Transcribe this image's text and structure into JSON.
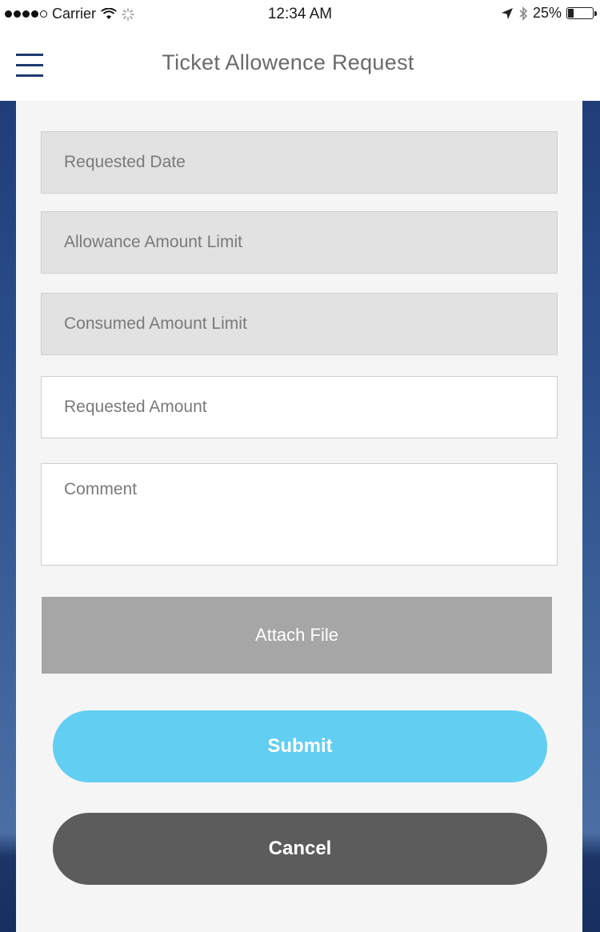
{
  "status_bar": {
    "carrier": "Carrier",
    "time": "12:34 AM",
    "battery": "25%",
    "battery_level": 0.25,
    "icons": [
      "signal-icon",
      "wifi-icon",
      "activity-spinner-icon",
      "location-arrow-icon",
      "bluetooth-icon",
      "battery-icon"
    ]
  },
  "header": {
    "title": "Ticket Allowence Request",
    "menu_icon": "hamburger-menu-icon"
  },
  "form": {
    "requested_date": {
      "placeholder": "Requested Date",
      "value": ""
    },
    "allowance_amount_limit": {
      "placeholder": "Allowance Amount Limit",
      "value": ""
    },
    "consumed_amount_limit": {
      "placeholder": "Consumed Amount Limit",
      "value": ""
    },
    "requested_amount": {
      "placeholder": "Requested Amount",
      "value": ""
    },
    "comment": {
      "placeholder": "Comment",
      "value": ""
    }
  },
  "buttons": {
    "attach": "Attach File",
    "submit": "Submit",
    "cancel": "Cancel"
  },
  "colors": {
    "accent_blue": "#62cef2",
    "cancel_gray": "#5c5c5c",
    "attach_gray": "#a6a6a6",
    "nav_icon": "#1d3a6e",
    "background": "#2a4d8a"
  }
}
